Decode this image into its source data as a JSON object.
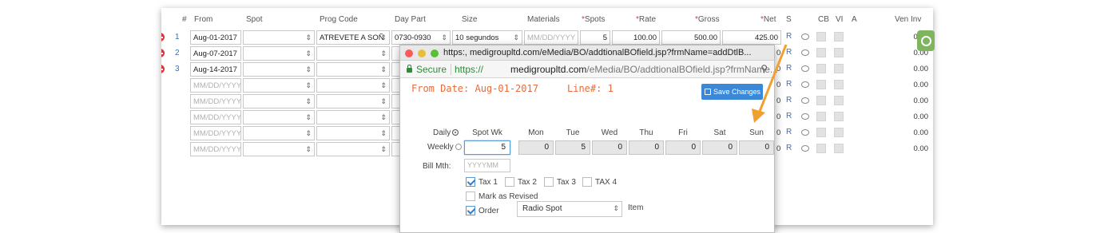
{
  "header": {
    "cols": {
      "hash": "#",
      "from": "From",
      "spot": "Spot",
      "prog_code": "Prog Code",
      "day_part": "Day Part",
      "size": "Size",
      "materials": "Materials",
      "spots": "Spots",
      "rate": "Rate",
      "gross": "Gross",
      "net": "Net",
      "s": "S",
      "cb": "CB",
      "vi": "VI",
      "a": "A",
      "ven_inv": "Ven Inv"
    },
    "req_mark": "*"
  },
  "rows": [
    {
      "num": "1",
      "from": "Aug-01-2017",
      "prog": "ATREVETE A SOÑ",
      "daypart": "0730-0930",
      "size": "10 segundos",
      "materials": "MM/DD/YYYY",
      "spots": "5",
      "rate": "100.00",
      "gross": "500.00",
      "net": "425.00",
      "r": "R",
      "ven": "0.00"
    },
    {
      "num": "2",
      "from": "Aug-07-2017",
      "r": "R",
      "ven": "0.00",
      "net_tail": "0"
    },
    {
      "num": "3",
      "from": "Aug-14-2017",
      "r": "R",
      "ven": "0.00",
      "net_tail": "0"
    },
    {
      "num": "",
      "from_ph": "MM/DD/YYYY",
      "r": "R",
      "ven": "0.00",
      "net_tail": "0"
    },
    {
      "num": "",
      "from_ph": "MM/DD/YYYY",
      "r": "R",
      "ven": "0.00",
      "net_tail": "0"
    },
    {
      "num": "",
      "from_ph": "MM/DD/YYYY",
      "r": "R",
      "ven": "0.00",
      "net_tail": "0"
    },
    {
      "num": "",
      "from_ph": "MM/DD/YYYY",
      "r": "R",
      "ven": "0.00",
      "net_tail": "0"
    },
    {
      "num": "",
      "from_ph": "MM/DD/YYYY",
      "r": "R",
      "ven": "0.00",
      "net_tail": "0"
    }
  ],
  "popup": {
    "titlebar": "https:,            medigroupltd.com/eMedia/BO/addtionalBOfield.jsp?frmName=addDtlB...",
    "secure": "Secure",
    "url_scheme": "https://",
    "url_domain": "medigroupltd.com",
    "url_path": "/eMedia/BO/addtionalBOfield.jsp?frmName...",
    "from_date": "From Date: Aug-01-2017",
    "line_no": "Line#: 1",
    "save_label": "Save Changes",
    "daily_label": "Daily",
    "weekly_label": "Weekly",
    "bill_label": "Bill Mth:",
    "bill_placeholder": "YYYYMM",
    "days": [
      {
        "label": "Spot Wk",
        "value": "5"
      },
      {
        "label": "Mon",
        "value": "0"
      },
      {
        "label": "Tue",
        "value": "5"
      },
      {
        "label": "Wed",
        "value": "0"
      },
      {
        "label": "Thu",
        "value": "0"
      },
      {
        "label": "Fri",
        "value": "0"
      },
      {
        "label": "Sat",
        "value": "0"
      },
      {
        "label": "Sun",
        "value": "0"
      }
    ],
    "tax1": "Tax 1",
    "tax2": "Tax 2",
    "tax3": "Tax 3",
    "tax4": "TAX 4",
    "mark_revised": "Mark as Revised",
    "order_label": "Order",
    "order_value": "Radio Spot",
    "item_label": "Item"
  },
  "colors": {
    "accent": "#3b88d8",
    "required": "#d9363e",
    "orange": "#e86a3a",
    "secure_green": "#2e8b3a",
    "arrow": "#f0a030"
  }
}
